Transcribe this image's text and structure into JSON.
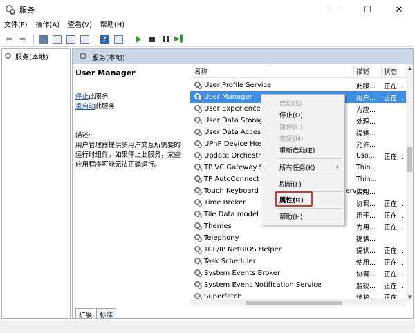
{
  "window": {
    "title": "服务",
    "minimize": "—",
    "maximize": "☐",
    "close": "✕"
  },
  "menu": [
    "文件(F)",
    "操作(A)",
    "查看(V)",
    "帮助(H)"
  ],
  "tree": {
    "root_label": "服务(本地)"
  },
  "pane_header": {
    "title": "服务(本地)"
  },
  "detail": {
    "service_name": "User Manager",
    "stop_link": "停止",
    "stop_suffix": "此服务",
    "restart_link": "重启动",
    "restart_suffix": "此服务",
    "desc_label": "描述:",
    "description": "用户管理器提供多用户交互所需要的运行时组件。如果停止此服务，某些应用程序可能无法正确运行。"
  },
  "columns": {
    "name": "名称",
    "desc": "描述",
    "status": "状态"
  },
  "rows": [
    {
      "name": "User Profile Service",
      "desc": "此服...",
      "status": "正在..."
    },
    {
      "name": "User Manager",
      "desc": "用户...",
      "status": "正在..."
    },
    {
      "name": "User Experience Virtualization Service",
      "desc": "为应...",
      "status": ""
    },
    {
      "name": "User Data Storage",
      "desc": "处理...",
      "status": ""
    },
    {
      "name": "User Data Access",
      "desc": "提供...",
      "status": ""
    },
    {
      "name": "UPnP Device Host",
      "desc": "允许...",
      "status": ""
    },
    {
      "name": "Update Orchestrator Service",
      "desc": "Uso...",
      "status": "正在..."
    },
    {
      "name": "TP VC Gateway Service",
      "desc": "Thin...",
      "status": ""
    },
    {
      "name": "TP AutoConnect Service",
      "desc": "Thin...",
      "status": ""
    },
    {
      "name": "Touch Keyboard and Handwriting Panel Service",
      "desc": "启用...",
      "status": ""
    },
    {
      "name": "Time Broker",
      "desc": "协调...",
      "status": "正在..."
    },
    {
      "name": "Tile Data model server",
      "desc": "用于...",
      "status": "正在..."
    },
    {
      "name": "Themes",
      "desc": "为用...",
      "status": "正在..."
    },
    {
      "name": "Telephony",
      "desc": "提供...",
      "status": ""
    },
    {
      "name": "TCP/IP NetBIOS Helper",
      "desc": "提供...",
      "status": "正在..."
    },
    {
      "name": "Task Scheduler",
      "desc": "使用...",
      "status": "正在..."
    },
    {
      "name": "System Events Broker",
      "desc": "协调...",
      "status": "正在..."
    },
    {
      "name": "System Event Notification Service",
      "desc": "监视...",
      "status": "正在..."
    },
    {
      "name": "Superfetch",
      "desc": "维护...",
      "status": "正在..."
    }
  ],
  "context_menu": {
    "start": "启动(S)",
    "stop": "停止(O)",
    "pause": "暂停(U)",
    "resume": "恢复(M)",
    "restart": "重新启动(E)",
    "all_tasks": "所有任务(K)",
    "all_tasks_arrow": "›",
    "refresh": "刷新(F)",
    "properties": "属性(R)",
    "help": "帮助(H)"
  },
  "tabs": {
    "extended": "扩展",
    "standard": "标准"
  },
  "colors": {
    "selection": "#3d8ee4",
    "highlight_box": "#e0342b",
    "link": "#1a55c4"
  }
}
